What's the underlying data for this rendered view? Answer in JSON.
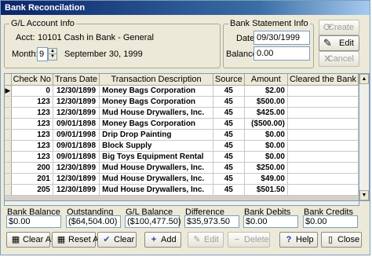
{
  "window": {
    "title": "Bank Reconcilation"
  },
  "gl_account": {
    "legend": "G/L Account Info",
    "acct_label": "Acct:",
    "acct_value": "10101 Cash in Bank - General",
    "month_label": "Month:",
    "month_value": "9",
    "month_date": "September 30, 1999"
  },
  "bank_statement": {
    "legend": "Bank Statement Info",
    "date_label": "Date:",
    "date_value": "09/30/1999",
    "balance_label": "Balance:",
    "balance_value": "0.00"
  },
  "side_buttons": {
    "create": "Create",
    "edit": "Edit",
    "cancel": "Cancel"
  },
  "grid": {
    "columns": [
      "Check No",
      "Trans Date",
      "Transaction Description",
      "Source",
      "Amount",
      "Cleared the Bank"
    ],
    "rows": [
      {
        "check": "0",
        "date": "12/30/1899",
        "desc": "Money Bags Corporation",
        "source": "45",
        "amount": "$2.00",
        "cleared": ""
      },
      {
        "check": "123",
        "date": "12/30/1899",
        "desc": "Money Bags Corporation",
        "source": "45",
        "amount": "$500.00",
        "cleared": ""
      },
      {
        "check": "123",
        "date": "12/30/1899",
        "desc": "Mud House Drywallers, Inc.",
        "source": "45",
        "amount": "$425.00",
        "cleared": ""
      },
      {
        "check": "123",
        "date": "09/01/1898",
        "desc": "Money Bags Corporation",
        "source": "45",
        "amount": "($500.00)",
        "cleared": ""
      },
      {
        "check": "123",
        "date": "09/01/1998",
        "desc": "Drip Drop Painting",
        "source": "45",
        "amount": "$0.00",
        "cleared": ""
      },
      {
        "check": "123",
        "date": "09/01/1898",
        "desc": "Block Supply",
        "source": "45",
        "amount": "$0.00",
        "cleared": ""
      },
      {
        "check": "123",
        "date": "09/01/1898",
        "desc": "Big Toys Equipment Rental",
        "source": "45",
        "amount": "$0.00",
        "cleared": ""
      },
      {
        "check": "200",
        "date": "12/30/1899",
        "desc": "Mud House Drywallers, Inc.",
        "source": "45",
        "amount": "$250.00",
        "cleared": ""
      },
      {
        "check": "201",
        "date": "12/30/1899",
        "desc": "Mud House Drywallers, Inc.",
        "source": "45",
        "amount": "$49.00",
        "cleared": ""
      },
      {
        "check": "205",
        "date": "12/30/1899",
        "desc": "Mud House Drywallers, Inc.",
        "source": "45",
        "amount": "$501.50",
        "cleared": ""
      }
    ]
  },
  "summary": {
    "bank_balance": {
      "label": "Bank Balance",
      "value": "$0.00"
    },
    "outstanding": {
      "label": "Outstanding",
      "value": "($64,504.00)"
    },
    "gl_balance": {
      "label": "G/L Balance",
      "value": "($100,477.50)"
    },
    "difference": {
      "label": "Difference",
      "value": "$35,973.50"
    },
    "bank_debits": {
      "label": "Bank Debits",
      "value": "$0.00"
    },
    "bank_credits": {
      "label": "Bank Credits",
      "value": "$0.00"
    }
  },
  "bottom_buttons": {
    "clear_all": "Clear All",
    "reset_all": "Reset All",
    "clear": "Clear",
    "add": "Add",
    "edit": "Edit",
    "delete": "Delete",
    "help": "Help",
    "close": "Close"
  }
}
